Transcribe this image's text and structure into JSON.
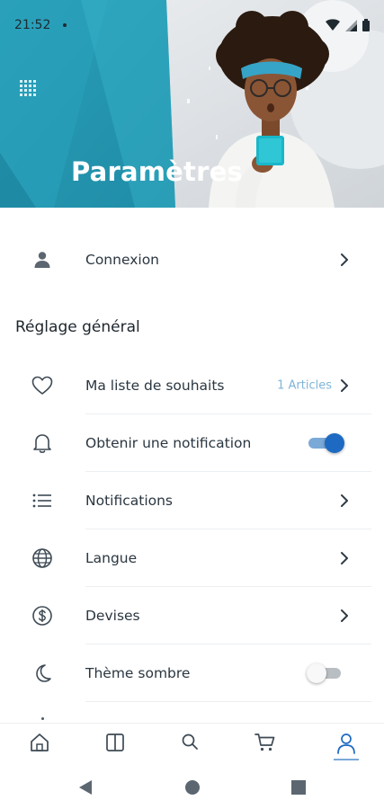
{
  "status_bar": {
    "time": "21:52"
  },
  "header": {
    "title": "Paramètres"
  },
  "account": {
    "login_label": "Connexion"
  },
  "general": {
    "section_title": "Réglage général",
    "items": [
      {
        "label": "Ma liste de souhaits",
        "icon": "heart-icon",
        "badge": "1 Articles",
        "control": "chevron"
      },
      {
        "label": "Obtenir une notification",
        "icon": "bell-icon",
        "control": "toggle",
        "toggle_on": true
      },
      {
        "label": "Notifications",
        "icon": "list-icon",
        "control": "chevron"
      },
      {
        "label": "Langue",
        "icon": "globe-icon",
        "control": "chevron"
      },
      {
        "label": "Devises",
        "icon": "dollar-icon",
        "control": "chevron"
      },
      {
        "label": "Thème sombre",
        "icon": "moon-icon",
        "control": "toggle",
        "toggle_on": false
      }
    ]
  },
  "bottom_nav": {
    "items": [
      "home-icon",
      "catalog-icon",
      "search-icon",
      "cart-icon",
      "profile-icon"
    ],
    "active": "profile-icon"
  },
  "colors": {
    "accent": "#1e6ac2",
    "accent_light": "#7aa9d8",
    "teal": "#3aaec4",
    "text": "#2a3640"
  }
}
